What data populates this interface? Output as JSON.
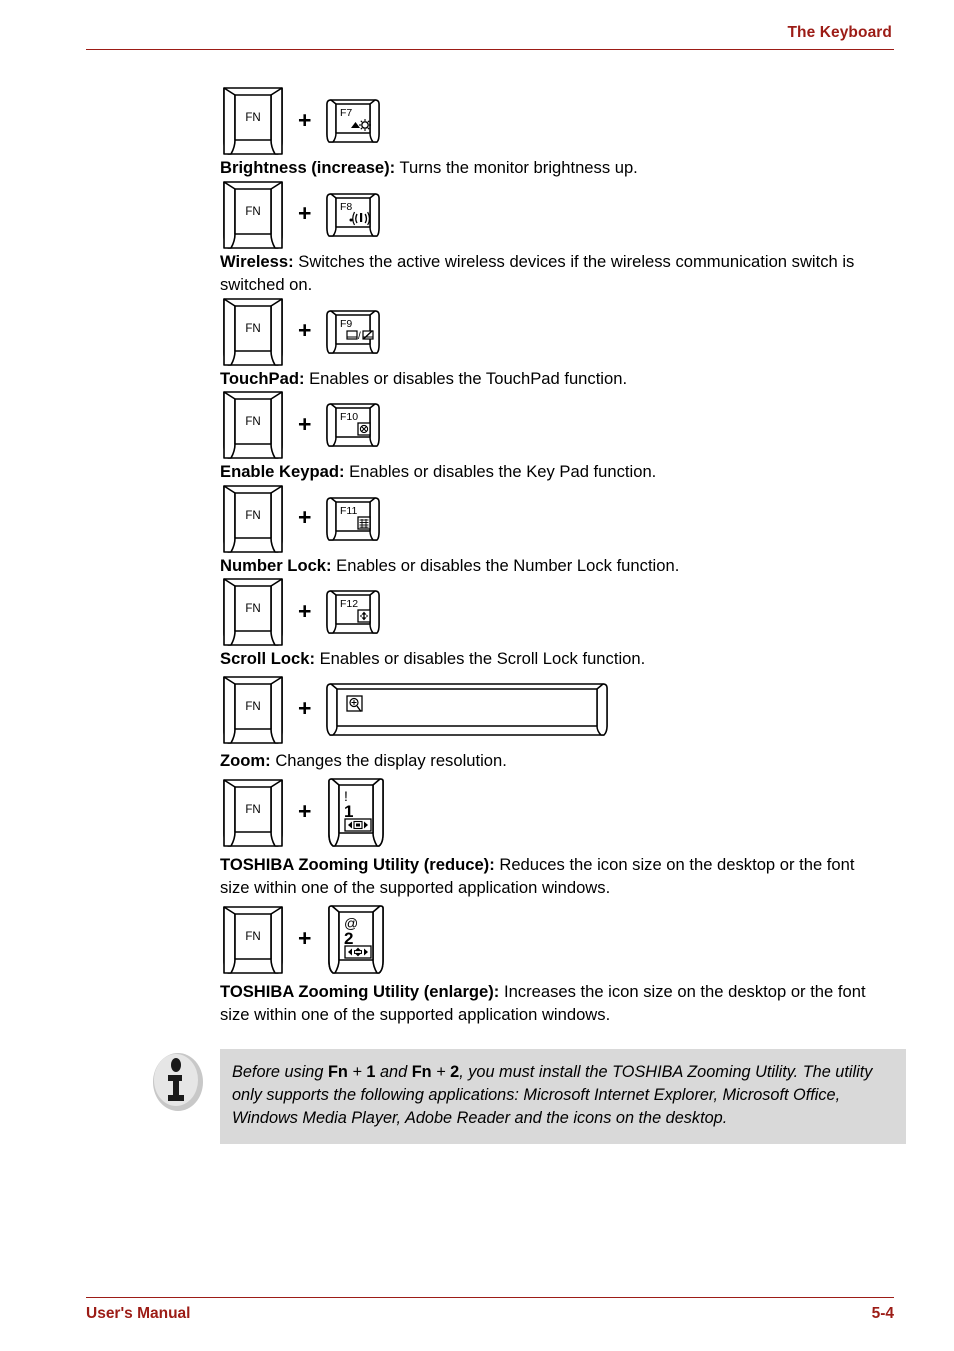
{
  "header": {
    "title": "The Keyboard"
  },
  "footer": {
    "manual_label": "User's Manual",
    "page_number": "5-4"
  },
  "colors": {
    "accent": "#9c1c16",
    "note_background": "#d9d9d9",
    "text": "#000000"
  },
  "plus_symbol": "+",
  "modifier_key": {
    "label": "FN",
    "icon": "fn-key-icon"
  },
  "entries": [
    {
      "id": "brightness-increase",
      "key": {
        "type": "function-key",
        "label": "F7",
        "icon": "brightness-up-icon",
        "icon_caption": "▲☼"
      },
      "term": "Brightness (increase):",
      "text": " Turns the monitor brightness up."
    },
    {
      "id": "wireless",
      "key": {
        "type": "function-key",
        "label": "F8",
        "icon": "wireless-antenna-icon",
        "icon_caption": "·»(·"
      },
      "term": "Wireless:",
      "text": " Switches the active wireless devices if the wireless communication switch is switched on."
    },
    {
      "id": "touchpad",
      "key": {
        "type": "function-key",
        "label": "F9",
        "icon": "touchpad-disable-icon",
        "icon_caption": "▭/▨"
      },
      "term": "TouchPad:",
      "text": " Enables or disables the TouchPad function."
    },
    {
      "id": "enable-keypad",
      "key": {
        "type": "function-key",
        "label": "F10",
        "icon": "keypad-icon",
        "icon_caption": "⊗"
      },
      "term": "Enable Keypad:",
      "text": " Enables or disables the Key Pad function."
    },
    {
      "id": "number-lock",
      "key": {
        "type": "function-key",
        "label": "F11",
        "icon": "numlock-icon",
        "icon_caption": "▦"
      },
      "term": "Number Lock:",
      "text": " Enables or disables the Number Lock function."
    },
    {
      "id": "scroll-lock",
      "key": {
        "type": "function-key",
        "label": "F12",
        "icon": "scrolllock-icon",
        "icon_caption": "↕"
      },
      "term": "Scroll Lock:",
      "text": " Enables or disables the Scroll Lock function."
    },
    {
      "id": "zoom",
      "key": {
        "type": "space-bar",
        "label": "",
        "icon": "magnifier-zoom-icon",
        "icon_caption": "⊕"
      },
      "term": "Zoom:",
      "text": " Changes the display resolution."
    },
    {
      "id": "toshiba-zooming-reduce",
      "key": {
        "type": "number-key",
        "label": "1",
        "label_top": "!",
        "icon": "zoom-reduce-icon",
        "icon_caption": "◄▣►"
      },
      "term": "TOSHIBA Zooming Utility (reduce):",
      "text": " Reduces the icon size on the desktop or the font size within one of the supported application windows."
    },
    {
      "id": "toshiba-zooming-enlarge",
      "key": {
        "type": "number-key",
        "label": "2",
        "label_top": "@",
        "icon": "zoom-enlarge-icon",
        "icon_caption": "◄⇕►"
      },
      "term": "TOSHIBA Zooming Utility (enlarge):",
      "text": " Increases the icon size on the desktop or the font size within one of the supported application windows."
    }
  ],
  "note": {
    "icon": "info-icon",
    "part1": "Before using ",
    "fn1": "Fn",
    "plus1": " + ",
    "key1": "1",
    "and": " and ",
    "fn2": "Fn",
    "plus2": " + ",
    "key2": "2",
    "part2": ", you must install the TOSHIBA Zooming Utility. The utility only supports the following applications: Microsoft Internet Explorer, Microsoft Office, Windows Media Player, Adobe Reader and the icons on the desktop."
  }
}
